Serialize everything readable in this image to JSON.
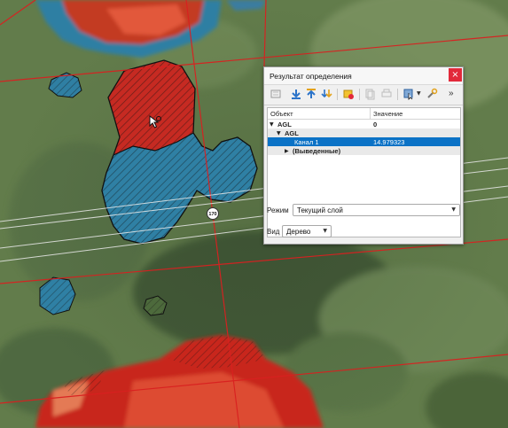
{
  "panel": {
    "title": "Результат определения",
    "close_glyph": "×",
    "more_glyph": "»",
    "toolbar_icons": [
      "expand-icon",
      "expand-new-icon",
      "collapse-icon",
      "expand-all-icon",
      "clear-results-icon",
      "copy-icon",
      "print-icon",
      "select-feature-icon",
      "settings-icon"
    ],
    "columns": {
      "object": "Объект",
      "value": "Значение"
    },
    "rows": [
      {
        "arrow": "▼",
        "name": "AGL",
        "value": "0"
      },
      {
        "arrow": "▼",
        "name": "AGL",
        "value": ""
      },
      {
        "arrow": "",
        "name": "Канал 1",
        "value": "14.979323"
      },
      {
        "arrow": "▶",
        "name": "(Выведенные)",
        "value": ""
      }
    ],
    "mode": {
      "label": "Режим",
      "value": "Текущий слой"
    },
    "view": {
      "label": "Вид",
      "value": "Дерево"
    }
  },
  "map": {
    "road_label": "170"
  },
  "colors": {
    "accent_selected": "#0b72c6",
    "close_red": "#e2293a",
    "crs_line_red": "#d92020",
    "raster_red": "#c8281f",
    "raster_blue": "#2e7ea3",
    "grass": "#5f7a4a"
  }
}
